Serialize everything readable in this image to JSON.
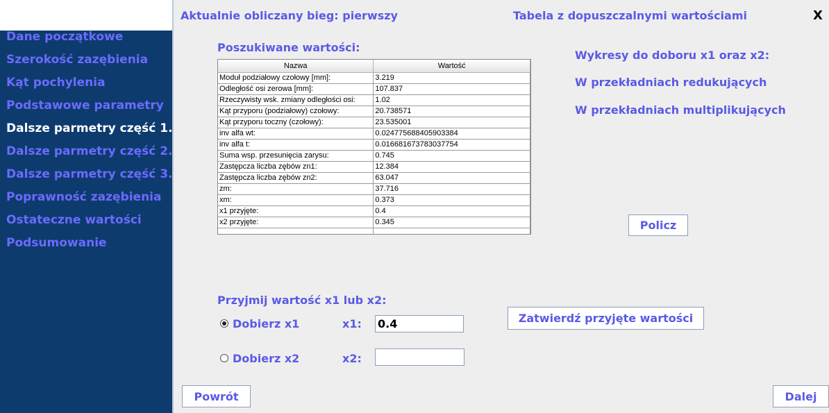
{
  "sidebar": {
    "items": [
      {
        "label": "Dane początkowe",
        "active": false
      },
      {
        "label": "Szerokość zazębienia",
        "active": false
      },
      {
        "label": "Kąt pochylenia",
        "active": false
      },
      {
        "label": "Podstawowe parametry",
        "active": false
      },
      {
        "label": "Dalsze parmetry część 1.",
        "active": true
      },
      {
        "label": "Dalsze parmetry część 2.",
        "active": false
      },
      {
        "label": "Dalsze parmetry część 3.",
        "active": false
      },
      {
        "label": "Poprawność zazębienia",
        "active": false
      },
      {
        "label": "Ostateczne wartości",
        "active": false
      },
      {
        "label": "Podsumowanie",
        "active": false
      }
    ]
  },
  "header": {
    "gear_title": "Aktualnie obliczany bieg: pierwszy",
    "table_link": "Tabela z dopuszczalnymi wartościami",
    "close_label": "X"
  },
  "results": {
    "title": "Poszukiwane wartości:",
    "columns": [
      "Nazwa",
      "Wartość"
    ],
    "rows": [
      [
        "Moduł podziałowy czołowy [mm]:",
        "3.219"
      ],
      [
        "Odległość osi zerowa [mm]:",
        "107.837"
      ],
      [
        "Rzeczywisty wsk. zmiany odległości osi:",
        "1.02"
      ],
      [
        "Kąt przyporu (podziałowy) czołowy:",
        "20.738571"
      ],
      [
        "Kąt przyporu toczny (czołowy):",
        "23.535001"
      ],
      [
        "inv alfa wt:",
        "0.024775688405903384"
      ],
      [
        "inv alfa t:",
        "0.016681673783037754"
      ],
      [
        "Suma wsp. przesunięcia zarysu:",
        "0.745"
      ],
      [
        "Zastępcza liczba zębów zn1:",
        "12.384"
      ],
      [
        "Zastępcza liczba zębów zn2:",
        "63.047"
      ],
      [
        "zm:",
        "37.716"
      ],
      [
        "xm:",
        "0.373"
      ],
      [
        "x1 przyjęte:",
        "0.4"
      ],
      [
        "x2 przyjęte:",
        "0.345"
      ]
    ]
  },
  "charts_panel": {
    "title": "Wykresy do doboru x1 oraz x2:",
    "link_reducing": "W przekładniach redukujących",
    "link_multiplying": "W przekładniach multiplikujących",
    "compute_button": "Policz"
  },
  "accept": {
    "title": "Przyjmij wartość x1 lub x2:",
    "option_x1": "Dobierz x1",
    "option_x2": "Dobierz x2",
    "selected": "x1",
    "label_x1": "x1:",
    "label_x2": "x2:",
    "value_x1": "0.4",
    "value_x2": "",
    "confirm_button": "Zatwierdź przyjęte wartości"
  },
  "footer": {
    "back_button": "Powrót",
    "next_button": "Dalej"
  },
  "colors": {
    "sidebar_bg": "#0d3b6e",
    "accent": "#5a5ae6",
    "active_item": "#ffffff"
  }
}
